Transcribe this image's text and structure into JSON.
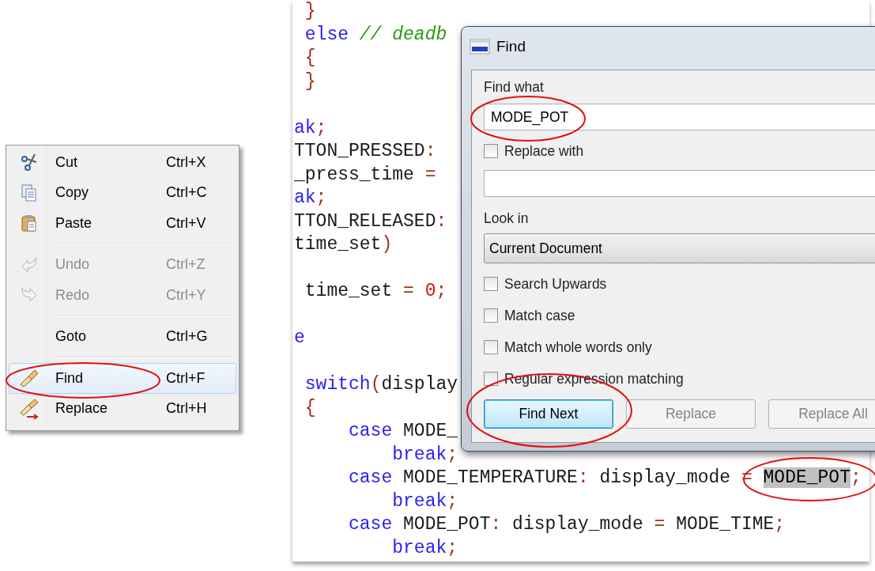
{
  "context_menu": {
    "items": [
      {
        "kind": "item",
        "label": "Cut",
        "shortcut": "Ctrl+X",
        "disabled": false,
        "selected": false
      },
      {
        "kind": "item",
        "label": "Copy",
        "shortcut": "Ctrl+C",
        "disabled": false,
        "selected": false
      },
      {
        "kind": "item",
        "label": "Paste",
        "shortcut": "Ctrl+V",
        "disabled": false,
        "selected": false
      },
      {
        "kind": "separator"
      },
      {
        "kind": "item",
        "label": "Undo",
        "shortcut": "Ctrl+Z",
        "disabled": true,
        "selected": false
      },
      {
        "kind": "item",
        "label": "Redo",
        "shortcut": "Ctrl+Y",
        "disabled": true,
        "selected": false
      },
      {
        "kind": "separator"
      },
      {
        "kind": "item",
        "label": "Goto",
        "shortcut": "Ctrl+G",
        "disabled": false,
        "selected": false
      },
      {
        "kind": "separator"
      },
      {
        "kind": "item",
        "label": "Find",
        "shortcut": "Ctrl+F",
        "disabled": false,
        "selected": true
      },
      {
        "kind": "item",
        "label": "Replace",
        "shortcut": "Ctrl+H",
        "disabled": false,
        "selected": false
      }
    ]
  },
  "editor": {
    "lines": [
      {
        "kind": "code",
        "tokens": [
          {
            "text": " }",
            "kind": "op"
          }
        ]
      },
      {
        "kind": "code",
        "tokens": [
          {
            "text": " else",
            "kind": "kw"
          },
          {
            "text": " // deadb",
            "kind": "comment"
          }
        ]
      },
      {
        "kind": "code",
        "tokens": [
          {
            "text": " {",
            "kind": "op"
          }
        ]
      },
      {
        "kind": "code",
        "tokens": [
          {
            "text": " }",
            "kind": "op"
          }
        ]
      },
      {
        "kind": "blank"
      },
      {
        "kind": "code",
        "tokens": [
          {
            "text": "ak",
            "kind": "kw"
          },
          {
            "text": ";",
            "kind": "op"
          }
        ]
      },
      {
        "kind": "code",
        "tokens": [
          {
            "text": "TTON_PRESSED",
            "kind": "text"
          },
          {
            "text": ":",
            "kind": "op"
          }
        ]
      },
      {
        "kind": "code",
        "tokens": [
          {
            "text": "_press_time ",
            "kind": "text"
          },
          {
            "text": "=",
            "kind": "op"
          }
        ]
      },
      {
        "kind": "code",
        "tokens": [
          {
            "text": "ak",
            "kind": "kw"
          },
          {
            "text": ";",
            "kind": "op"
          }
        ]
      },
      {
        "kind": "code",
        "tokens": [
          {
            "text": "TTON_RELEASED",
            "kind": "text"
          },
          {
            "text": ":",
            "kind": "op"
          }
        ]
      },
      {
        "kind": "code",
        "tokens": [
          {
            "text": "time_set",
            "kind": "text"
          },
          {
            "text": ")",
            "kind": "op"
          }
        ]
      },
      {
        "kind": "blank"
      },
      {
        "kind": "code",
        "tokens": [
          {
            "text": " time_set ",
            "kind": "text"
          },
          {
            "text": "= ",
            "kind": "op"
          },
          {
            "text": "0",
            "kind": "num"
          },
          {
            "text": ";",
            "kind": "op"
          }
        ]
      },
      {
        "kind": "blank"
      },
      {
        "kind": "code",
        "tokens": [
          {
            "text": "e",
            "kind": "kw"
          }
        ]
      },
      {
        "kind": "blank"
      },
      {
        "kind": "code",
        "tokens": [
          {
            "text": " switch",
            "kind": "kw"
          },
          {
            "text": "(",
            "kind": "op"
          },
          {
            "text": "display",
            "kind": "text"
          }
        ]
      },
      {
        "kind": "code",
        "tokens": [
          {
            "text": " {",
            "kind": "op"
          }
        ]
      },
      {
        "kind": "code",
        "tokens": [
          {
            "text": "     case",
            "kind": "kw"
          },
          {
            "text": " MODE_",
            "kind": "text"
          }
        ]
      },
      {
        "kind": "code",
        "tokens": [
          {
            "text": "         break",
            "kind": "kw"
          },
          {
            "text": ";",
            "kind": "op"
          }
        ]
      },
      {
        "kind": "code",
        "tokens": [
          {
            "text": "     case",
            "kind": "kw"
          },
          {
            "text": " MODE_TEMPERATURE",
            "kind": "text"
          },
          {
            "text": ":",
            "kind": "op"
          },
          {
            "text": " display_mode ",
            "kind": "text"
          },
          {
            "text": "= ",
            "kind": "op"
          },
          {
            "text": "MODE_POT",
            "kind": "match"
          },
          {
            "text": ";",
            "kind": "op"
          }
        ]
      },
      {
        "kind": "code",
        "tokens": [
          {
            "text": "         break",
            "kind": "kw"
          },
          {
            "text": ";",
            "kind": "op"
          }
        ]
      },
      {
        "kind": "code",
        "tokens": [
          {
            "text": "     case",
            "kind": "kw"
          },
          {
            "text": " MODE_POT",
            "kind": "text"
          },
          {
            "text": ":",
            "kind": "op"
          },
          {
            "text": " display_mode ",
            "kind": "text"
          },
          {
            "text": "=",
            "kind": "op"
          },
          {
            "text": " MODE_TIME",
            "kind": "text"
          },
          {
            "text": ";",
            "kind": "op"
          }
        ]
      },
      {
        "kind": "code",
        "tokens": [
          {
            "text": "         break",
            "kind": "kw"
          },
          {
            "text": ";",
            "kind": "op"
          }
        ]
      }
    ]
  },
  "find_dialog": {
    "title": "Find",
    "find_what_label": "Find what",
    "find_what_value": "MODE_POT",
    "replace_with": {
      "label": "Replace with",
      "checked": false
    },
    "look_in_label": "Look in",
    "look_in_value": "Current Document",
    "options": [
      {
        "label": "Search Upwards",
        "checked": false
      },
      {
        "label": "Match case",
        "checked": false
      },
      {
        "label": "Match whole words only",
        "checked": false
      },
      {
        "label": "Regular expression matching",
        "checked": false
      }
    ],
    "buttons": [
      {
        "label": "Find Next",
        "default": true,
        "disabled": false
      },
      {
        "label": "Replace",
        "default": false,
        "disabled": true
      },
      {
        "label": "Replace All",
        "default": false,
        "disabled": true
      }
    ]
  }
}
